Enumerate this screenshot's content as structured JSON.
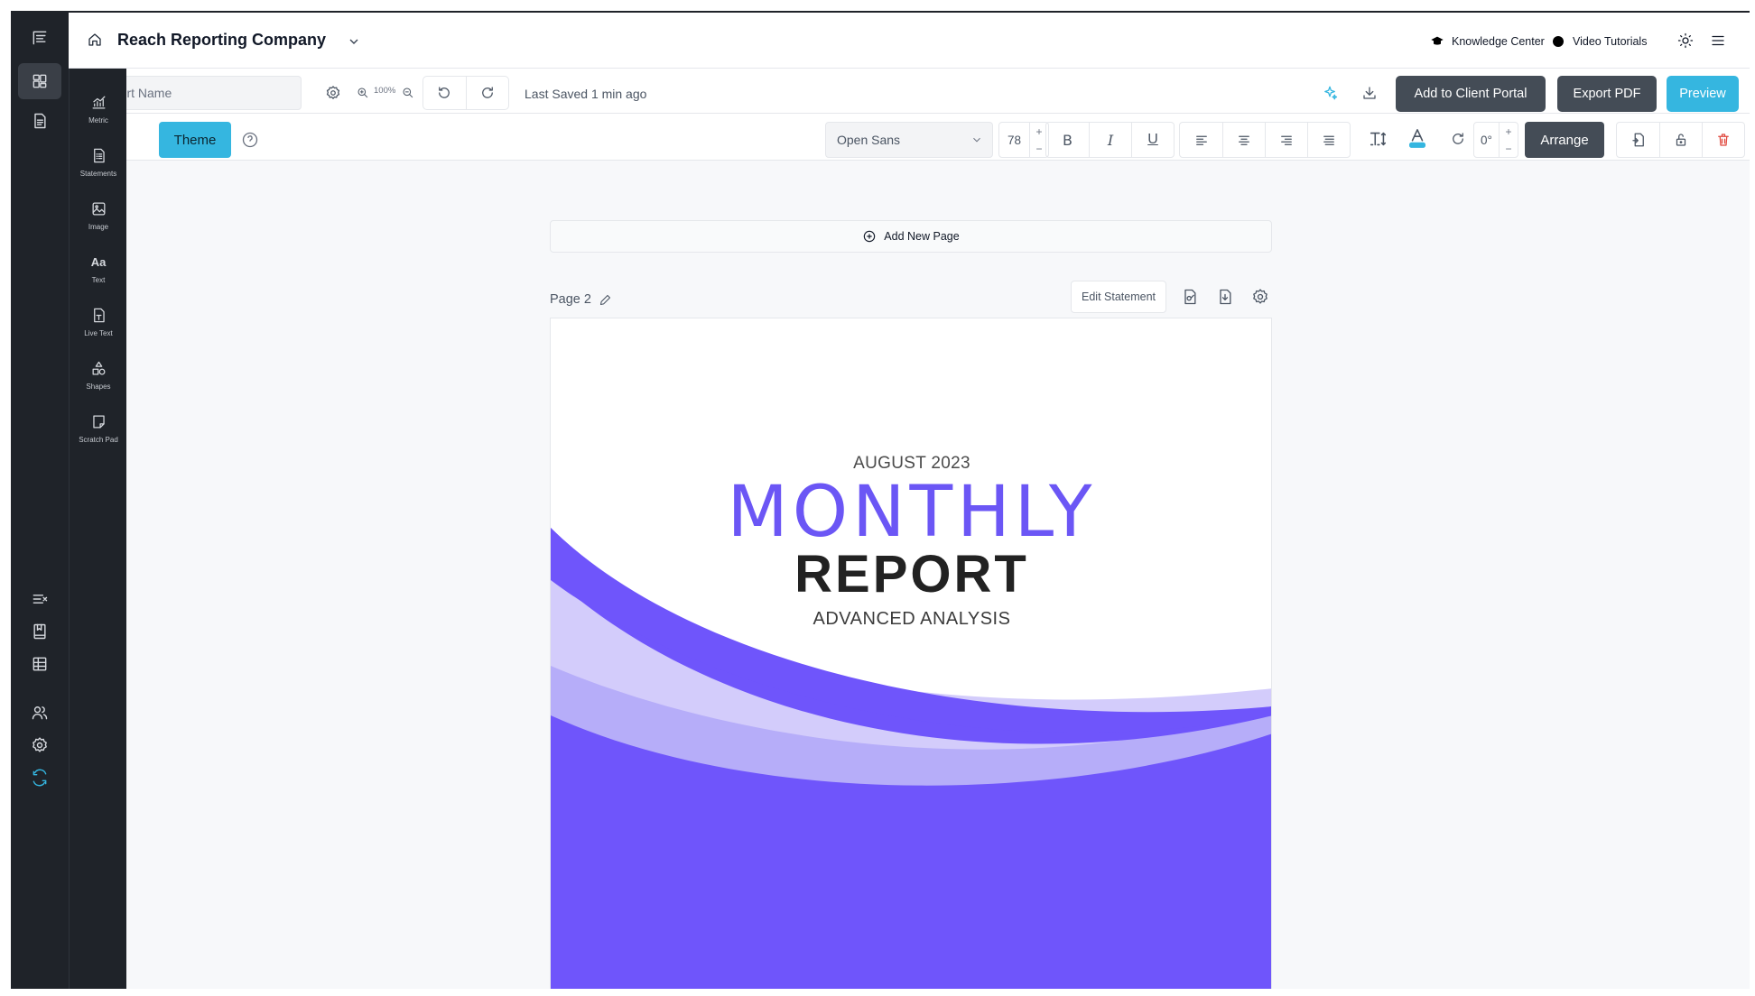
{
  "header": {
    "company": "Reach Reporting Company",
    "knowledge_center": "Knowledge Center",
    "video_tutorials": "Video Tutorials"
  },
  "toolbar": {
    "report_name_placeholder": "Report Name",
    "zoom": "100%",
    "last_saved": "Last Saved 1 min ago",
    "add_to_client_portal": "Add to Client Portal",
    "export_pdf": "Export PDF",
    "preview": "Preview"
  },
  "format_bar": {
    "theme": "Theme",
    "font": "Open Sans",
    "font_size": "78",
    "rotation": "0°",
    "arrange": "Arrange",
    "bold": "B",
    "italic": "I",
    "underline": "U"
  },
  "elements_panel": {
    "items": [
      {
        "label": "Metric",
        "icon": "chart-icon"
      },
      {
        "label": "Statements",
        "icon": "statement-icon"
      },
      {
        "label": "Image",
        "icon": "image-icon"
      },
      {
        "label": "Text",
        "icon": "text-icon"
      },
      {
        "label": "Live Text",
        "icon": "live-text-icon"
      },
      {
        "label": "Shapes",
        "icon": "shapes-icon"
      },
      {
        "label": "Scratch Pad",
        "icon": "scratch-pad-icon"
      }
    ]
  },
  "canvas": {
    "add_new_page": "Add New Page",
    "page_label": "Page 2",
    "edit_statement": "Edit Statement"
  },
  "page_content": {
    "date": "AUGUST 2023",
    "title_line1": "MONTHLY",
    "title_line2": "REPORT",
    "subtitle": "ADVANCED ANALYSIS"
  },
  "colors": {
    "accent_blue": "#35b6e0",
    "dark_button": "#444c56",
    "purple": "#6b56f5",
    "light_purple": "#cfc8fb",
    "mid_purple": "#b6adf9",
    "delete_red": "#e0483e"
  }
}
